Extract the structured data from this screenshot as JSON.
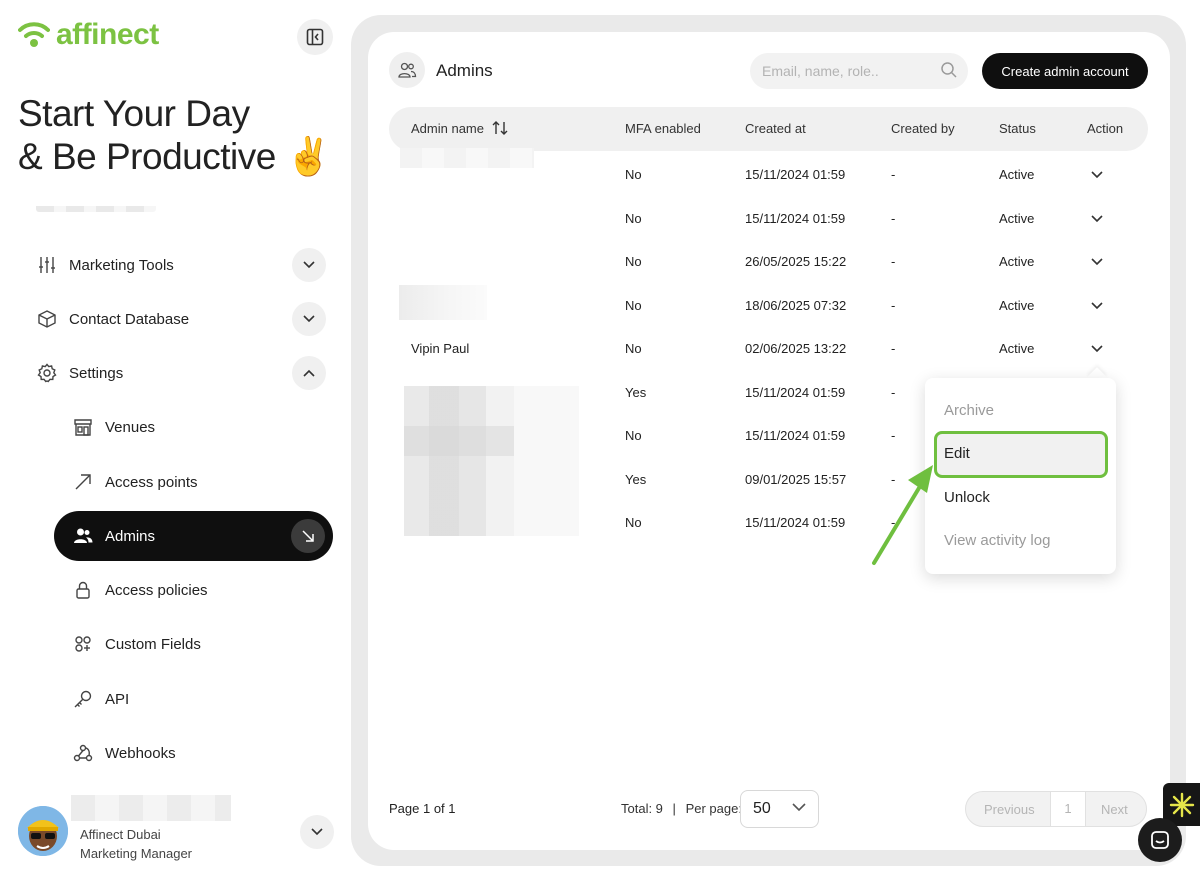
{
  "brand": {
    "name": "affinect",
    "color": "#7cc242"
  },
  "sidebar": {
    "headline_line1": "Start Your Day",
    "headline_line2": "& Be Productive ✌️",
    "items": [
      {
        "label": "Marketing Tools",
        "icon": "sliders-icon",
        "expanded": false
      },
      {
        "label": "Contact Database",
        "icon": "cube-icon",
        "expanded": false
      },
      {
        "label": "Settings",
        "icon": "gear-icon",
        "expanded": true
      }
    ],
    "subitems": [
      {
        "label": "Venues",
        "icon": "store-icon"
      },
      {
        "label": "Access points",
        "icon": "arrow-up-right-icon"
      },
      {
        "label": "Admins",
        "icon": "users-icon",
        "active": true
      },
      {
        "label": "Access policies",
        "icon": "lock-icon"
      },
      {
        "label": "Custom Fields",
        "icon": "fields-icon"
      },
      {
        "label": "API",
        "icon": "key-icon"
      },
      {
        "label": "Webhooks",
        "icon": "webhook-icon"
      }
    ],
    "profile": {
      "name": "Affinect Dubai",
      "role": "Marketing Manager"
    }
  },
  "page": {
    "title": "Admins",
    "search_placeholder": "Email, name, role..",
    "create_button": "Create admin account"
  },
  "table": {
    "columns": [
      "Admin name",
      "MFA enabled",
      "Created at",
      "Created by",
      "Status",
      "Action"
    ],
    "rows": [
      {
        "name": "",
        "mfa": "No",
        "created_at": "15/11/2024 01:59",
        "created_by": "-",
        "status": "Active"
      },
      {
        "name": "",
        "mfa": "No",
        "created_at": "15/11/2024 01:59",
        "created_by": "-",
        "status": "Active"
      },
      {
        "name": "",
        "mfa": "No",
        "created_at": "26/05/2025 15:22",
        "created_by": "-",
        "status": "Active"
      },
      {
        "name": "",
        "mfa": "No",
        "created_at": "18/06/2025 07:32",
        "created_by": "-",
        "status": "Active"
      },
      {
        "name": "Vipin Paul",
        "mfa": "No",
        "created_at": "02/06/2025 13:22",
        "created_by": "-",
        "status": "Active"
      },
      {
        "name": "",
        "mfa": "Yes",
        "created_at": "15/11/2024 01:59",
        "created_by": "-",
        "status": ""
      },
      {
        "name": "",
        "mfa": "No",
        "created_at": "15/11/2024 01:59",
        "created_by": "-",
        "status": ""
      },
      {
        "name": "",
        "mfa": "Yes",
        "created_at": "09/01/2025 15:57",
        "created_by": "-",
        "status": ""
      },
      {
        "name": "",
        "mfa": "No",
        "created_at": "15/11/2024 01:59",
        "created_by": "-",
        "status": ""
      }
    ]
  },
  "action_menu": {
    "items": [
      {
        "label": "Archive",
        "enabled": false
      },
      {
        "label": "Edit",
        "enabled": true,
        "highlighted": true
      },
      {
        "label": "Unlock",
        "enabled": true
      },
      {
        "label": "View activity log",
        "enabled": false
      }
    ]
  },
  "pagination": {
    "page_text": "Page 1 of 1",
    "total_text": "Total: 9",
    "per_page_label": "Per page:",
    "per_page_value": "50",
    "prev": "Previous",
    "current": "1",
    "next": "Next"
  },
  "colors": {
    "accent_green": "#6fbf3f",
    "dark": "#0f0f0f",
    "disabled": "#9a9a9a"
  }
}
